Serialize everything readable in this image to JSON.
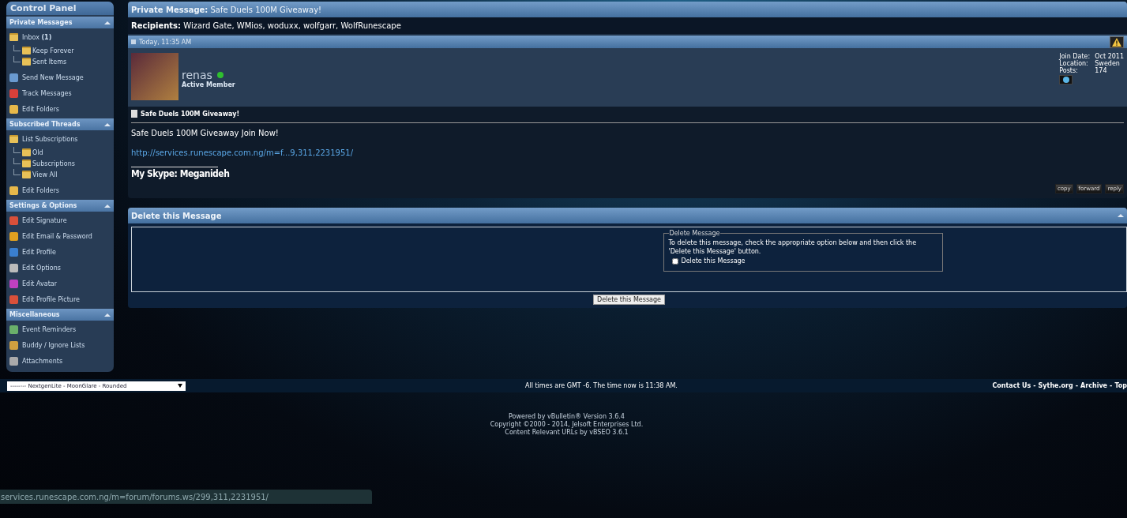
{
  "sidebar": {
    "title": "Control Panel",
    "sections": [
      {
        "heading": "Private Messages",
        "expanded": true,
        "items": [
          {
            "kind": "folder",
            "label": "Inbox **(1)**",
            "children": [
              {
                "kind": "folder",
                "label": "Keep Forever"
              },
              {
                "kind": "folder",
                "label": "Sent Items"
              }
            ]
          },
          {
            "kind": "link",
            "label": "Send New Message"
          },
          {
            "kind": "link",
            "label": "Track Messages"
          },
          {
            "kind": "link",
            "label": "Edit Folders"
          }
        ]
      },
      {
        "heading": "Subscribed Threads",
        "expanded": true,
        "items": [
          {
            "kind": "folder",
            "label": "List Subscriptions",
            "children": [
              {
                "kind": "folder",
                "label": "Old"
              },
              {
                "kind": "folder",
                "label": "Subscriptions"
              },
              {
                "kind": "folder",
                "label": "View All"
              }
            ]
          },
          {
            "kind": "link",
            "label": "Edit Folders"
          }
        ]
      },
      {
        "heading": "Settings & Options",
        "expanded": true,
        "items": [
          {
            "kind": "link",
            "label": "Edit Signature"
          },
          {
            "kind": "link",
            "label": "Edit Email & Password"
          },
          {
            "kind": "link",
            "label": "Edit Profile"
          },
          {
            "kind": "link",
            "label": "Edit Options"
          },
          {
            "kind": "link",
            "label": "Edit Avatar"
          },
          {
            "kind": "link",
            "label": "Edit Profile Picture"
          }
        ]
      },
      {
        "heading": "Miscellaneous",
        "expanded": true,
        "items": [
          {
            "kind": "link",
            "label": "Event Reminders"
          },
          {
            "kind": "link",
            "label": "Buddy / Ignore Lists"
          },
          {
            "kind": "link",
            "label": "Attachments"
          }
        ]
      }
    ]
  },
  "message": {
    "heading_label": "Private Message:",
    "heading_title": "Safe Duels 100M Giveaway!",
    "recipients_label": "Recipients:",
    "recipients": "Wizard Gate, WMios, woduxx, wolfgarr, WolfRunescape",
    "date": "Today, 11:35 AM",
    "author": {
      "name": "renas",
      "online": true,
      "title": "Active Member",
      "info": [
        {
          "label": "Join Date:",
          "value": "Oct 2011"
        },
        {
          "label": "Location:",
          "value": "Sweden"
        },
        {
          "label": "Posts:",
          "value": "174"
        }
      ]
    },
    "title": "Safe Duels 100M Giveaway!",
    "body": "Safe Duels 100M Giveaway Join Now!",
    "link": "http://services.runescape.com.ng/m=f...9,311,2231951/",
    "signature": "My Skype: Meganideh",
    "buttons": [
      "copy",
      "forward",
      "reply"
    ]
  },
  "delete_panel": {
    "title": "Delete this Message",
    "legend": "Delete Message",
    "text": "To delete this message, check the appropriate option below and then click the 'Delete this Message' button.",
    "checkbox": {
      "label": "Delete this Message",
      "checked": false
    },
    "button": "Delete this Message"
  },
  "footer": {
    "style_select": "-------- NextgenLite - MoonGlare - Rounded",
    "time_text": "All times are GMT -6. The time now is 11:38 AM.",
    "links": [
      "Contact Us",
      "Sythe.org",
      "Archive",
      "Top"
    ],
    "separator": "-",
    "credits": [
      "Powered by vBulletin® Version 3.6.4",
      "Copyright ©2000 - 2014, Jelsoft Enterprises Ltd.",
      "Content Relevant URLs by vBSEO 3.6.1"
    ]
  },
  "status_bar": "services.runescape.com.ng/m=forum/forums.ws/299,311,2231951/"
}
